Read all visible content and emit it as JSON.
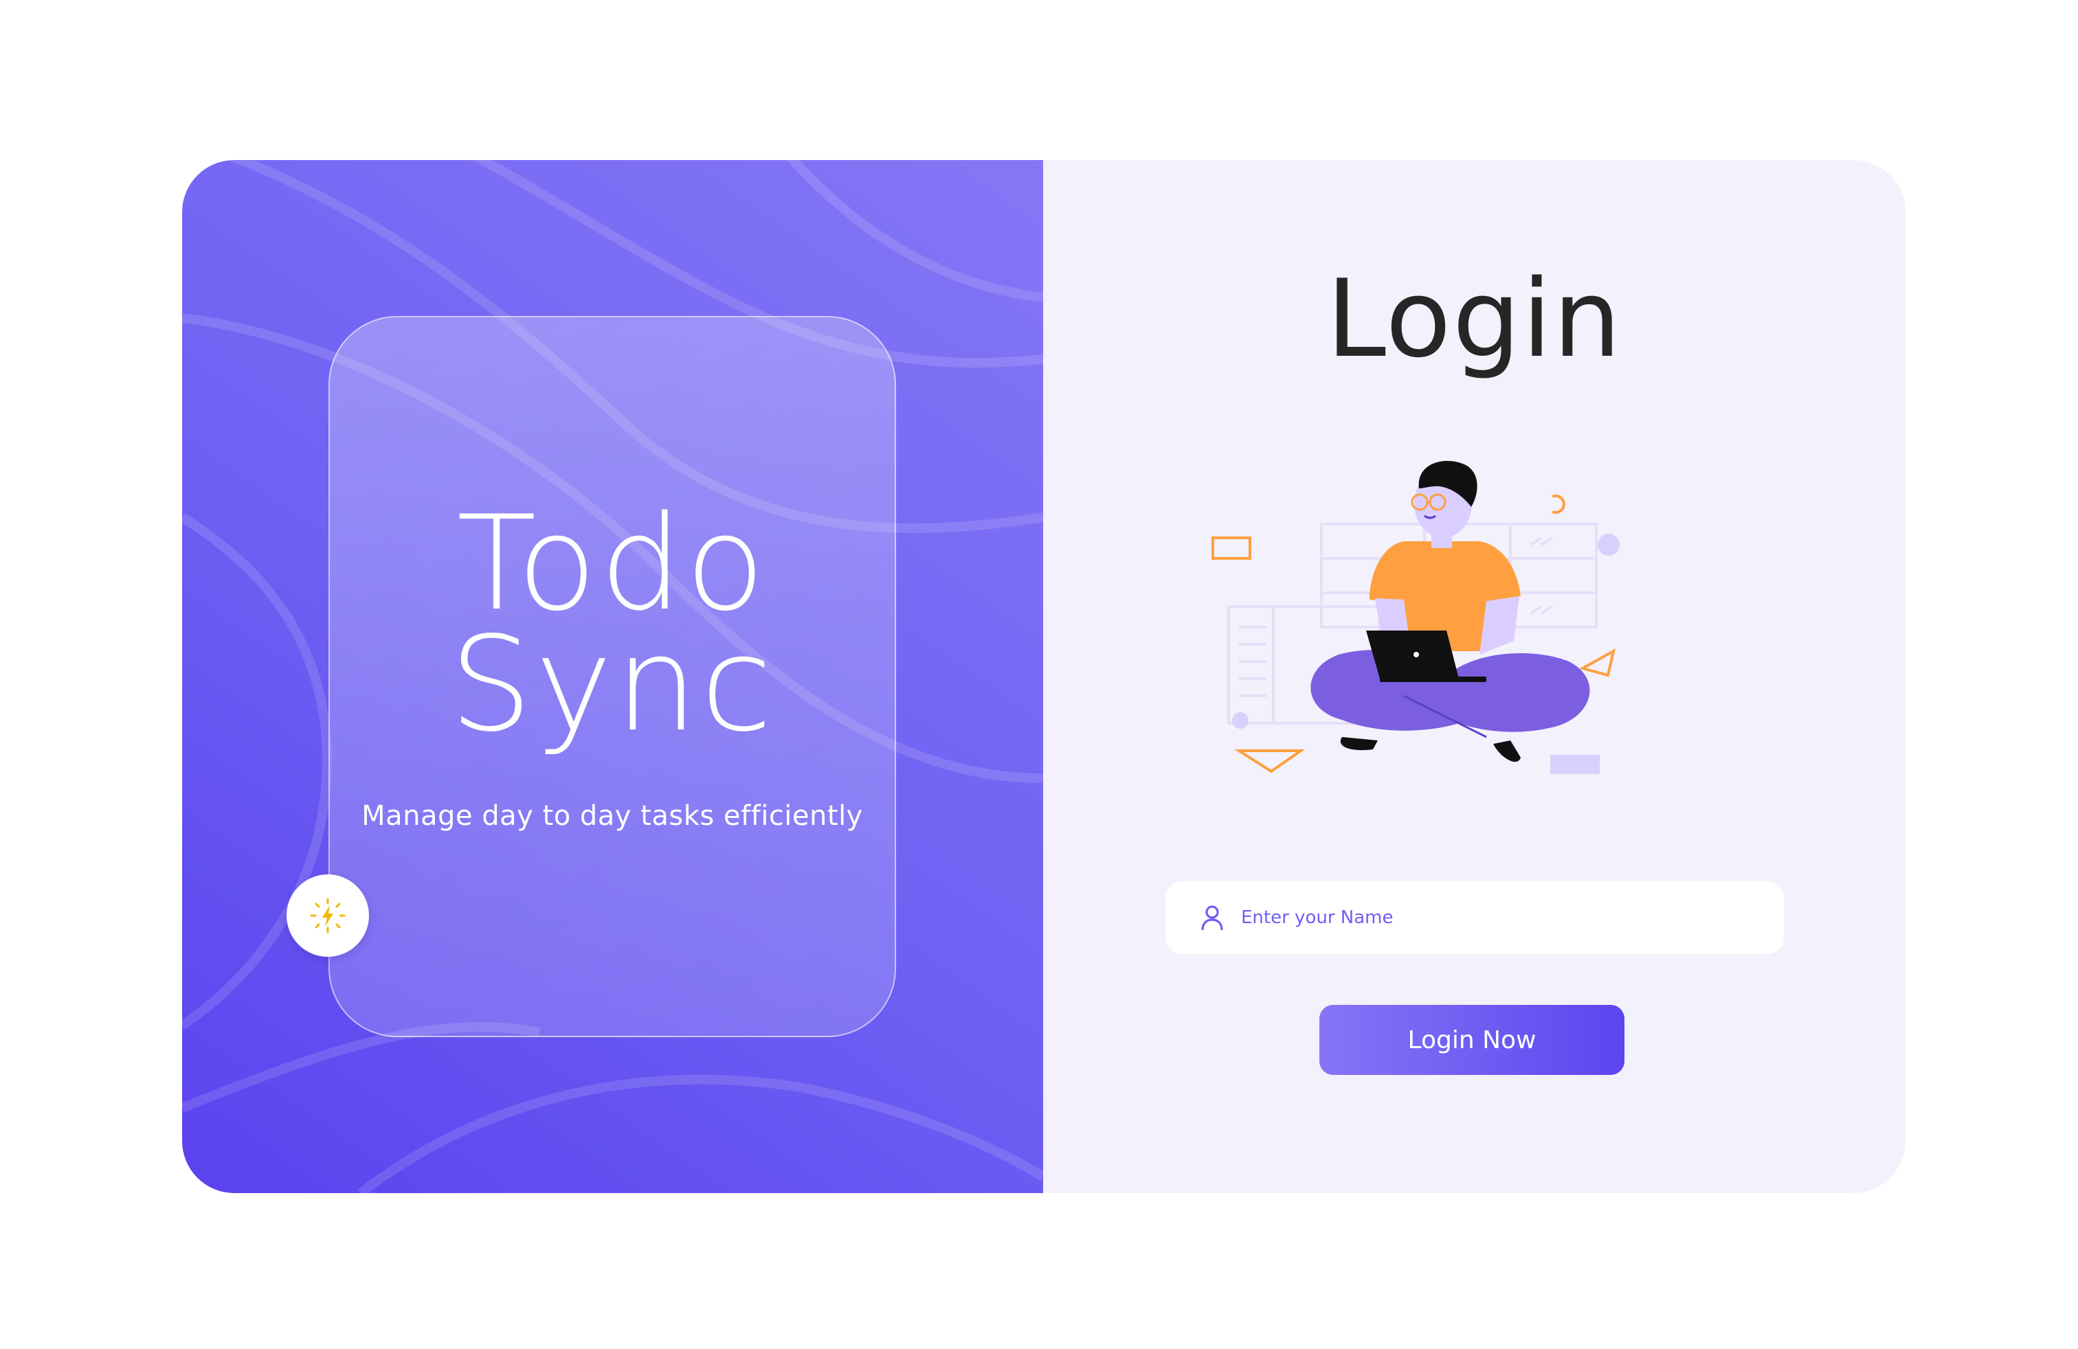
{
  "brand": {
    "title_line1": "Todo",
    "title_line2": "Sync",
    "tagline": "Manage day to day tasks efficiently",
    "badge_icon": "lightning-bolt-icon"
  },
  "login": {
    "title": "Login",
    "name_placeholder": "Enter your Name",
    "name_value": "",
    "input_icon": "user-icon",
    "submit_label": "Login Now",
    "illustration": "person-with-laptop-illustration"
  },
  "colors": {
    "primary": "#5b45ef",
    "primary_light": "#8676f6",
    "panel_bg": "#f3f1fc",
    "accent_orange": "#ff9f3f",
    "accent_yellow": "#f2b705"
  }
}
